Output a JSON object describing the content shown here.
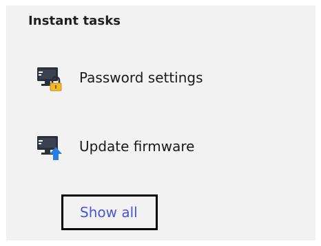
{
  "panel": {
    "title": "Instant tasks"
  },
  "tasks": [
    {
      "label": "Password settings",
      "icon": "computer-lock-icon"
    },
    {
      "label": "Update firmware",
      "icon": "computer-upload-icon"
    }
  ],
  "show_all": {
    "label": "Show all"
  },
  "colors": {
    "panel_bg": "#f2f2f3",
    "link": "#4a55d6",
    "lock": "#f2b92a",
    "upload_arrow": "#2a7de1",
    "monitor": "#2b2f3a"
  }
}
